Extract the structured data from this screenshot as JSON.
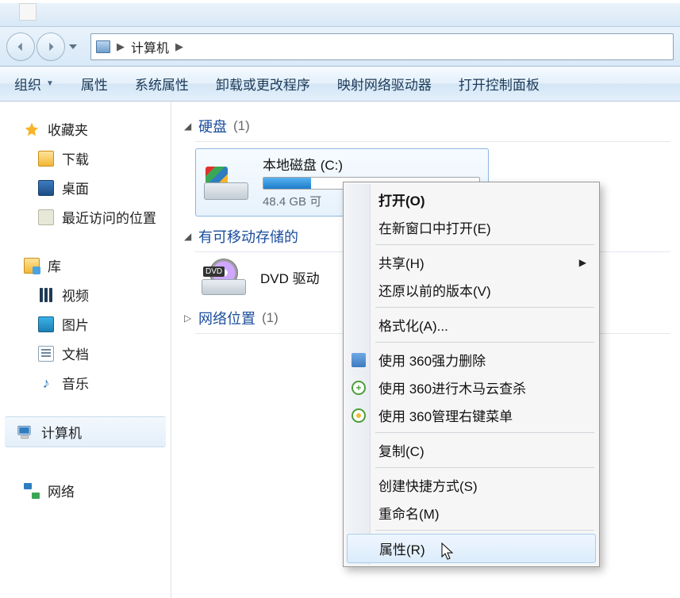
{
  "breadcrumb": {
    "root_label": "计算机"
  },
  "toolbar": {
    "organize": "组织",
    "properties": "属性",
    "system_properties": "系统属性",
    "uninstall": "卸载或更改程序",
    "map_drive": "映射网络驱动器",
    "control_panel": "打开控制面板"
  },
  "sidebar": {
    "favorites": "收藏夹",
    "downloads": "下载",
    "desktop": "桌面",
    "recent": "最近访问的位置",
    "libraries": "库",
    "videos": "视频",
    "pictures": "图片",
    "documents": "文档",
    "music": "音乐",
    "computer": "计算机",
    "network": "网络"
  },
  "content": {
    "group_disk": "硬盘",
    "group_disk_count": "(1)",
    "group_removable": "有可移动存储的",
    "group_network": "网络位置",
    "group_network_count": "(1)",
    "drive_c": {
      "name": "本地磁盘 (C:)",
      "free_text": "48.4 GB 可"
    },
    "dvd": {
      "name": "DVD 驱动"
    }
  },
  "context_menu": {
    "open": "打开(O)",
    "open_new_window": "在新窗口中打开(E)",
    "share": "共享(H)",
    "restore_prev": "还原以前的版本(V)",
    "format": "格式化(A)...",
    "use_360_delete": "使用 360强力删除",
    "use_360_scan": "使用 360进行木马云查杀",
    "use_360_menu": "使用 360管理右键菜单",
    "copy": "复制(C)",
    "create_shortcut": "创建快捷方式(S)",
    "rename": "重命名(M)",
    "properties": "属性(R)"
  }
}
